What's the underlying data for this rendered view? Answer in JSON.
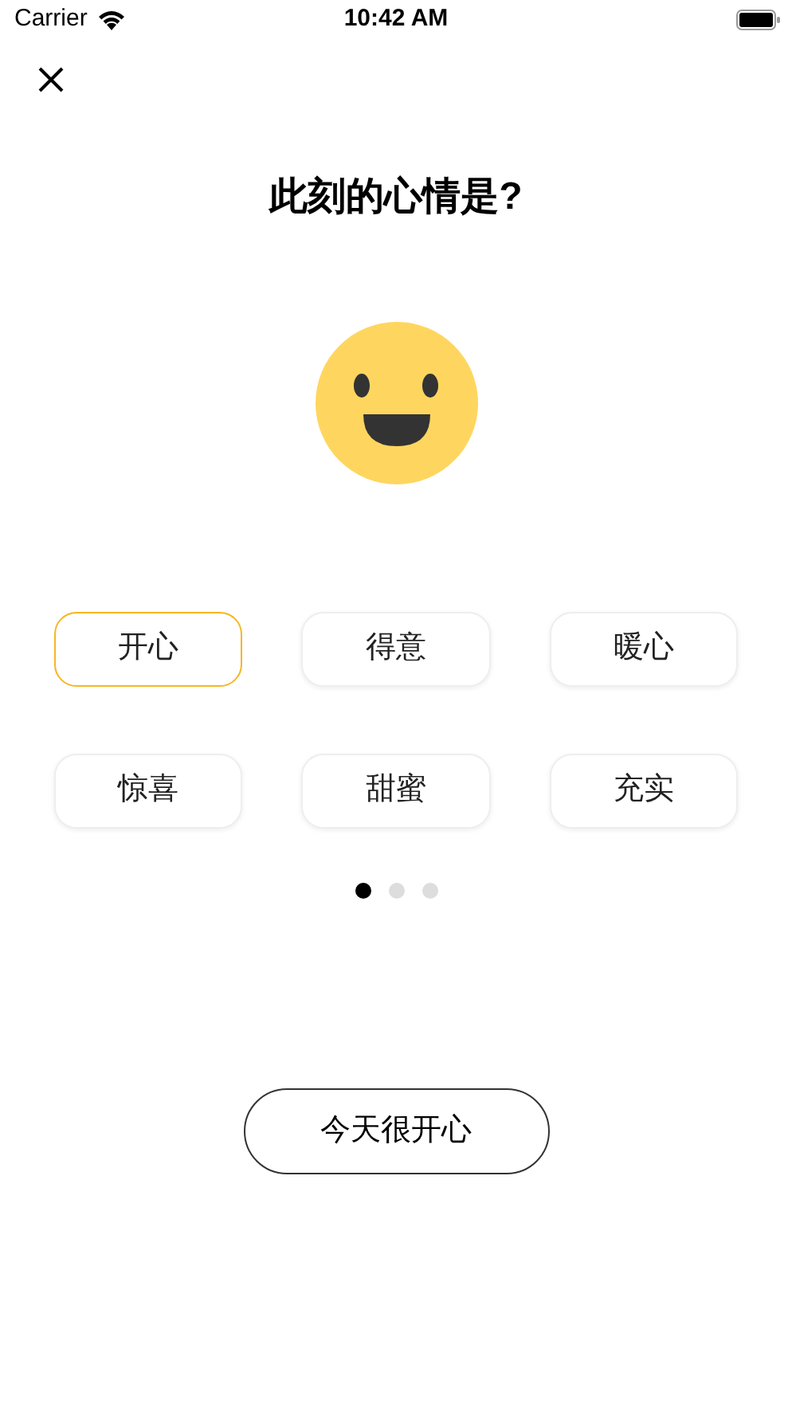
{
  "status_bar": {
    "carrier": "Carrier",
    "time": "10:42 AM"
  },
  "title": "此刻的心情是?",
  "moods": [
    {
      "label": "开心",
      "selected": true
    },
    {
      "label": "得意",
      "selected": false
    },
    {
      "label": "暖心",
      "selected": false
    },
    {
      "label": "惊喜",
      "selected": false
    },
    {
      "label": "甜蜜",
      "selected": false
    },
    {
      "label": "充实",
      "selected": false
    }
  ],
  "pages": [
    {
      "selected": true
    },
    {
      "selected": false
    },
    {
      "selected": false
    }
  ],
  "confirm_button": "今天很开心"
}
